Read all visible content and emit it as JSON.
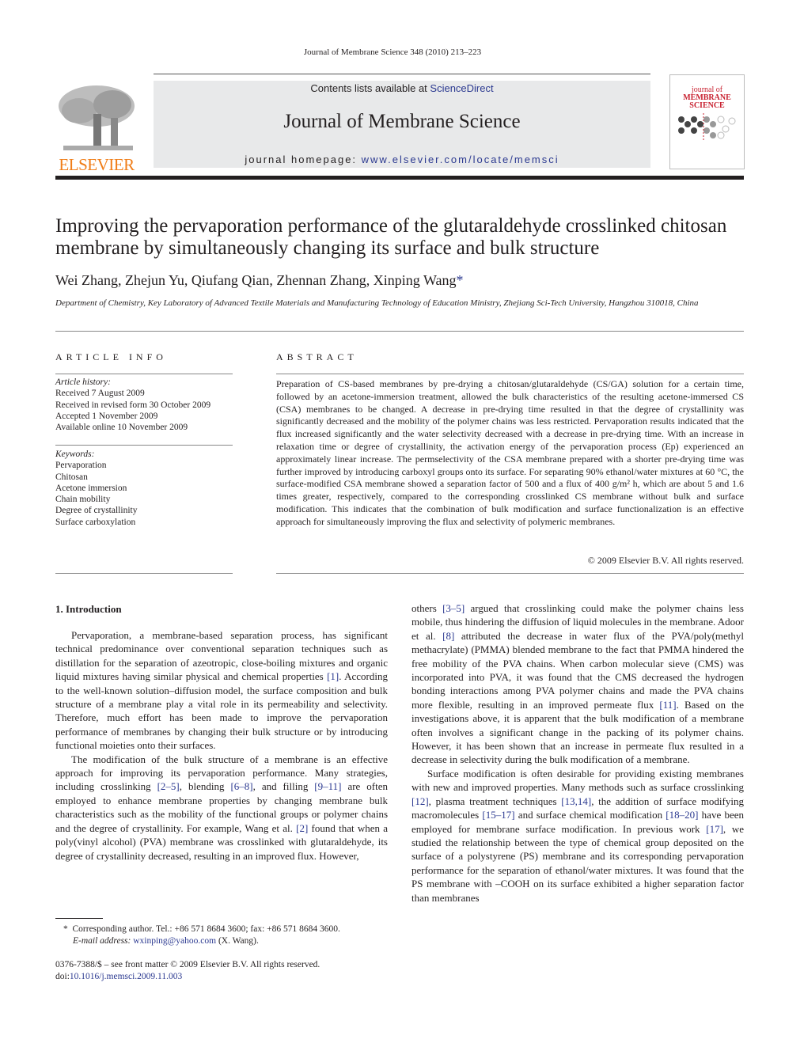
{
  "running_head": "Journal of Membrane Science 348 (2010) 213–223",
  "header": {
    "publisher_logo_text": "ELSEVIER",
    "contents_prefix": "Contents lists available at ",
    "contents_link": "ScienceDirect",
    "journal_title": "Journal of Membrane Science",
    "homepage_prefix": "journal homepage: ",
    "homepage_link": "www.elsevier.com/locate/memsci",
    "cover_line1": "journal of",
    "cover_line2": "MEMBRANE",
    "cover_line3": "SCIENCE",
    "colors": {
      "elsevier_orange": "#f07d17",
      "link_blue": "#2b3990",
      "banner_gray": "#e8e9ea",
      "cover_red": "#c8202f"
    }
  },
  "article": {
    "title": "Improving the pervaporation performance of the glutaraldehyde crosslinked chitosan membrane by simultaneously changing its surface and bulk structure",
    "authors": "Wei Zhang, Zhejun Yu, Qiufang Qian, Zhennan Zhang, Xinping Wang",
    "author_mark": "*",
    "affiliation": "Department of Chemistry, Key Laboratory of Advanced Textile Materials and Manufacturing Technology of Education Ministry, Zhejiang Sci-Tech University, Hangzhou 310018, China"
  },
  "article_info": {
    "heading": "ARTICLE INFO",
    "history_label": "Article history:",
    "history": [
      "Received 7 August 2009",
      "Received in revised form 30 October 2009",
      "Accepted 1 November 2009",
      "Available online 10 November 2009"
    ],
    "keywords_label": "Keywords:",
    "keywords": [
      "Pervaporation",
      "Chitosan",
      "Acetone immersion",
      "Chain mobility",
      "Degree of crystallinity",
      "Surface carboxylation"
    ]
  },
  "abstract": {
    "heading": "ABSTRACT",
    "text": "Preparation of CS-based membranes by pre-drying a chitosan/glutaraldehyde (CS/GA) solution for a certain time, followed by an acetone-immersion treatment, allowed the bulk characteristics of the resulting acetone-immersed CS (CSA) membranes to be changed. A decrease in pre-drying time resulted in that the degree of crystallinity was significantly decreased and the mobility of the polymer chains was less restricted. Pervaporation results indicated that the flux increased significantly and the water selectivity decreased with a decrease in pre-drying time. With an increase in relaxation time or degree of crystallinity, the activation energy of the pervaporation process (Ep) experienced an approximately linear increase. The permselectivity of the CSA membrane prepared with a shorter pre-drying time was further improved by introducing carboxyl groups onto its surface. For separating 90% ethanol/water mixtures at 60 °C, the surface-modified CSA membrane showed a separation factor of 500 and a flux of 400 g/m² h, which are about 5 and 1.6 times greater, respectively, compared to the corresponding crosslinked CS membrane without bulk and surface modification. This indicates that the combination of bulk modification and surface functionalization is an effective approach for simultaneously improving the flux and selectivity of polymeric membranes.",
    "copyright": "© 2009 Elsevier B.V. All rights reserved."
  },
  "introduction": {
    "heading": "1.  Introduction",
    "left_paragraphs": [
      [
        {
          "t": "Pervaporation, a membrane-based separation process, has significant technical predominance over conventional separation techniques such as distillation for the separation of azeotropic, close-boiling mixtures and organic liquid mixtures having similar physical and chemical properties "
        },
        {
          "ref": "[1]"
        },
        {
          "t": ". According to the well-known solution–diffusion model, the surface composition and bulk structure of a membrane play a vital role in its permeability and selectivity. Therefore, much effort has been made to improve the pervaporation performance of membranes by changing their bulk structure or by introducing functional moieties onto their surfaces."
        }
      ],
      [
        {
          "t": "The modification of the bulk structure of a membrane is an effective approach for improving its pervaporation performance. Many strategies, including crosslinking "
        },
        {
          "ref": "[2–5]"
        },
        {
          "t": ", blending "
        },
        {
          "ref": "[6–8]"
        },
        {
          "t": ", and filling "
        },
        {
          "ref": "[9–11]"
        },
        {
          "t": " are often employed to enhance membrane properties by changing membrane bulk characteristics such as the mobility of the functional groups or polymer chains and the degree of crystallinity. For example, Wang et al. "
        },
        {
          "ref": "[2]"
        },
        {
          "t": " found that when a poly(vinyl alcohol) (PVA) membrane was crosslinked with glutaraldehyde, its degree of crystallinity decreased, resulting in an improved flux. However,"
        }
      ]
    ],
    "right_paragraphs": [
      [
        {
          "t": "others "
        },
        {
          "ref": "[3–5]"
        },
        {
          "t": " argued that crosslinking could make the polymer chains less mobile, thus hindering the diffusion of liquid molecules in the membrane. Adoor et al. "
        },
        {
          "ref": "[8]"
        },
        {
          "t": " attributed the decrease in water flux of the PVA/poly(methyl methacrylate) (PMMA) blended membrane to the fact that PMMA hindered the free mobility of the PVA chains. When carbon molecular sieve (CMS) was incorporated into PVA, it was found that the CMS decreased the hydrogen bonding interactions among PVA polymer chains and made the PVA chains more flexible, resulting in an improved permeate flux "
        },
        {
          "ref": "[11]"
        },
        {
          "t": ". Based on the investigations above, it is apparent that the bulk modification of a membrane often involves a significant change in the packing of its polymer chains. However, it has been shown that an increase in permeate flux resulted in a decrease in selectivity during the bulk modification of a membrane."
        }
      ],
      [
        {
          "t": "Surface modification is often desirable for providing existing membranes with new and improved properties. Many methods such as surface crosslinking "
        },
        {
          "ref": "[12]"
        },
        {
          "t": ", plasma treatment techniques "
        },
        {
          "ref": "[13,14]"
        },
        {
          "t": ", the addition of surface modifying macromolecules "
        },
        {
          "ref": "[15–17]"
        },
        {
          "t": " and surface chemical modification "
        },
        {
          "ref": "[18–20]"
        },
        {
          "t": " have been employed for membrane surface modification. In previous work "
        },
        {
          "ref": "[17]"
        },
        {
          "t": ", we studied the relationship between the type of chemical group deposited on the surface of a polystyrene (PS) membrane and its corresponding pervaporation performance for the separation of ethanol/water mixtures. It was found that the PS membrane with –COOH on its surface exhibited a higher separation factor than membranes"
        }
      ]
    ]
  },
  "footnote": {
    "mark": "*",
    "text": "Corresponding author. Tel.: +86 571 8684 3600; fax: +86 571 8684 3600.",
    "email_label": "E-mail address: ",
    "email": "wxinping@yahoo.com",
    "email_suffix": " (X. Wang)."
  },
  "front_matter": {
    "issn_line": "0376-7388/$ – see front matter © 2009 Elsevier B.V. All rights reserved.",
    "doi_prefix": "doi:",
    "doi": "10.1016/j.memsci.2009.11.003"
  }
}
